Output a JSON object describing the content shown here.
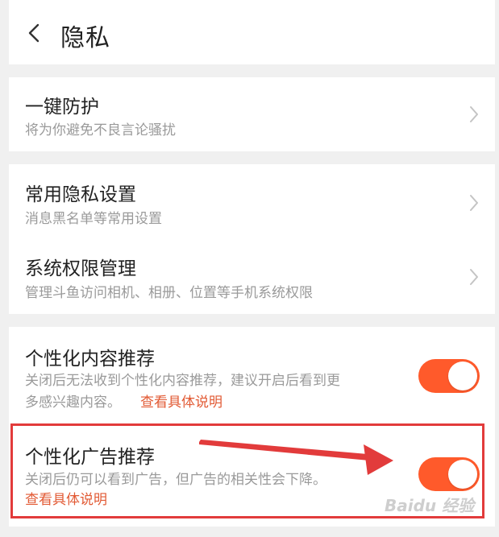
{
  "header": {
    "title": "隐私",
    "back_icon": "chevron-left-icon"
  },
  "sections": {
    "protection": {
      "title": "一键防护",
      "subtitle": "将为你避免不良言论骚扰"
    },
    "common_privacy": {
      "title": "常用隐私设置",
      "subtitle": "消息黑名单等常用设置"
    },
    "system_permissions": {
      "title": "系统权限管理",
      "subtitle": "管理斗鱼访问相机、相册、位置等手机系统权限"
    },
    "personalized_content": {
      "title": "个性化内容推荐",
      "subtitle_line1": "关闭后无法收到个性化内容推荐，建议开启后看到更",
      "subtitle_line2": "多感兴趣内容。",
      "link": "查看具体说明",
      "enabled": true
    },
    "personalized_ads": {
      "title": "个性化广告推荐",
      "subtitle": "关闭后仍可以看到广告，但广告的相关性会下降。",
      "link": "查看具体说明",
      "enabled": true
    }
  },
  "colors": {
    "toggle_on": "#ff5a2b",
    "link": "#e25a34",
    "annotation": "#e23b3b"
  },
  "watermark": "Baidu 经验"
}
